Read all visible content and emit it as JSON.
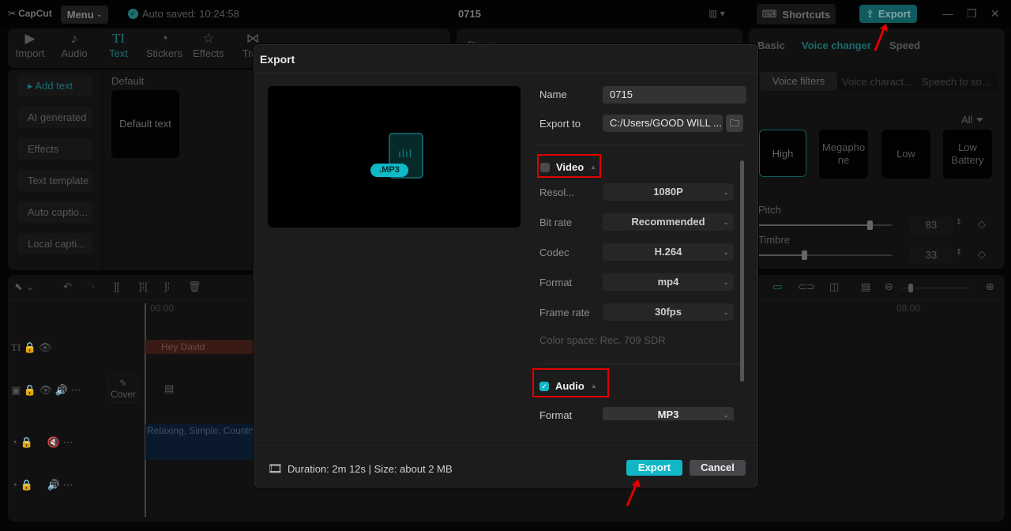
{
  "app": {
    "logo": "CapCut",
    "menu_label": "Menu",
    "autosave": "Auto saved: 10:24:58",
    "project_title": "0715",
    "shortcuts_label": "Shortcuts",
    "export_label": "Export"
  },
  "toolbar": {
    "tools": [
      {
        "label": "Import",
        "icon": "import-icon",
        "glyph": "▶"
      },
      {
        "label": "Audio",
        "icon": "audio-icon",
        "glyph": "♪"
      },
      {
        "label": "Text",
        "icon": "text-icon",
        "glyph": "TI"
      },
      {
        "label": "Stickers",
        "icon": "sticker-icon",
        "glyph": "◔"
      },
      {
        "label": "Effects",
        "icon": "effects-icon",
        "glyph": "☆"
      },
      {
        "label": "Tran",
        "icon": "transition-icon",
        "glyph": "⋈"
      }
    ]
  },
  "text_panel": {
    "nav": [
      "Add text",
      "AI generated",
      "Effects",
      "Text template",
      "Auto captio...",
      "Local capti..."
    ],
    "section": "Default",
    "card": "Default text"
  },
  "player": {
    "title": "Player"
  },
  "right_panel": {
    "tabs": [
      "Basic",
      "Voice changer",
      "Speed"
    ],
    "subtabs": [
      "Voice filters",
      "Voice charact...",
      "Speech to so..."
    ],
    "filter_label": "All",
    "presets": [
      "High",
      "Megapho ne",
      "Low",
      "Low Battery"
    ],
    "pitch_label": "Pitch",
    "pitch_value": "83",
    "timbre_label": "Timbre",
    "timbre_value": "33"
  },
  "timeline": {
    "start_time": "00:00",
    "end_time": "08:00",
    "text_clip": "Hey David",
    "cover_label": "Cover",
    "audio_clip": "Relaxing, Simple, Country"
  },
  "export_dialog": {
    "title": "Export",
    "file_badge": ".MP3",
    "name_label": "Name",
    "name_value": "0715",
    "export_to_label": "Export to",
    "export_to_value": "C:/Users/GOOD WILL ...",
    "video": {
      "title": "Video",
      "checked": false,
      "rows": [
        {
          "label": "Resol...",
          "value": "1080P"
        },
        {
          "label": "Bit rate",
          "value": "Recommended"
        },
        {
          "label": "Codec",
          "value": "H.264"
        },
        {
          "label": "Format",
          "value": "mp4"
        },
        {
          "label": "Frame rate",
          "value": "30fps"
        }
      ],
      "color_space": "Color space: Rec. 709 SDR"
    },
    "audio": {
      "title": "Audio",
      "checked": true,
      "format_label": "Format",
      "format_value": "MP3"
    },
    "footer_info": "Duration: 2m 12s | Size: about 2 MB",
    "export_button": "Export",
    "cancel_button": "Cancel"
  },
  "colors": {
    "accent": "#12b7c6",
    "annotation": "#e00000"
  }
}
